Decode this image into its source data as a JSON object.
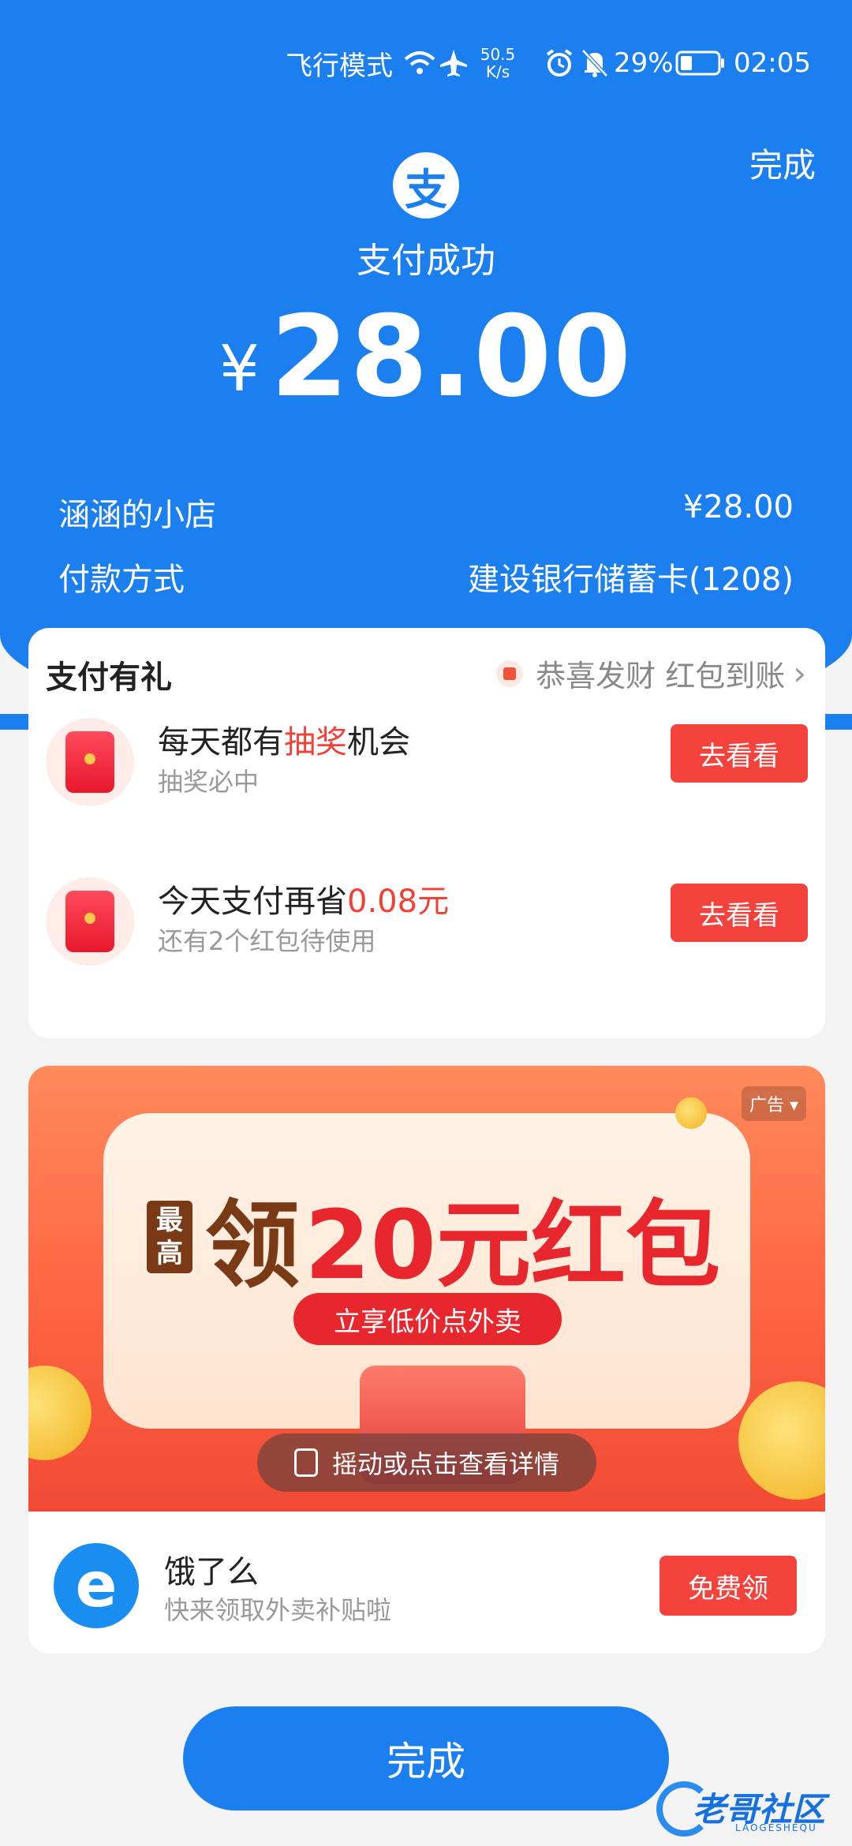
{
  "status_bar": {
    "airplane_mode": "飞行模式",
    "net_speed_value": "50.5",
    "net_speed_unit": "K/s",
    "battery": "29%",
    "time": "02:05"
  },
  "header": {
    "done_label": "完成",
    "status": "支付成功",
    "currency": "¥",
    "amount": "28.00"
  },
  "details": {
    "merchant": "涵涵的小店",
    "merchant_amount": "¥28.00",
    "method_label": "付款方式",
    "method_value": "建设银行储蓄卡(1208)"
  },
  "rewards": {
    "title": "支付有礼",
    "hint": "恭喜发财 红包到账",
    "items": [
      {
        "title_pre": "每天都有",
        "title_highlight": "抽奖",
        "title_post": "机会",
        "subtitle": "抽奖必中",
        "button": "去看看"
      },
      {
        "title_pre": "今天支付再省",
        "title_highlight": "0.08元",
        "title_post": "",
        "subtitle": "还有2个红包待使用",
        "button": "去看看"
      }
    ]
  },
  "ad": {
    "tag": "广告",
    "small_text": "最高",
    "headline_1": "领",
    "headline_2": "20元红包",
    "subline": "立享低价点外卖",
    "shake_text": "摇动或点击查看详情",
    "brand_name": "饿了么",
    "brand_desc": "快来领取外卖补贴啦",
    "button": "免费领"
  },
  "footer": {
    "done_label": "完成"
  },
  "watermark": {
    "text": "老哥社区",
    "sub": "LAOGESHEQU"
  },
  "colors": {
    "primary_blue": "#1b7ff0",
    "accent_red": "#f4433c"
  }
}
